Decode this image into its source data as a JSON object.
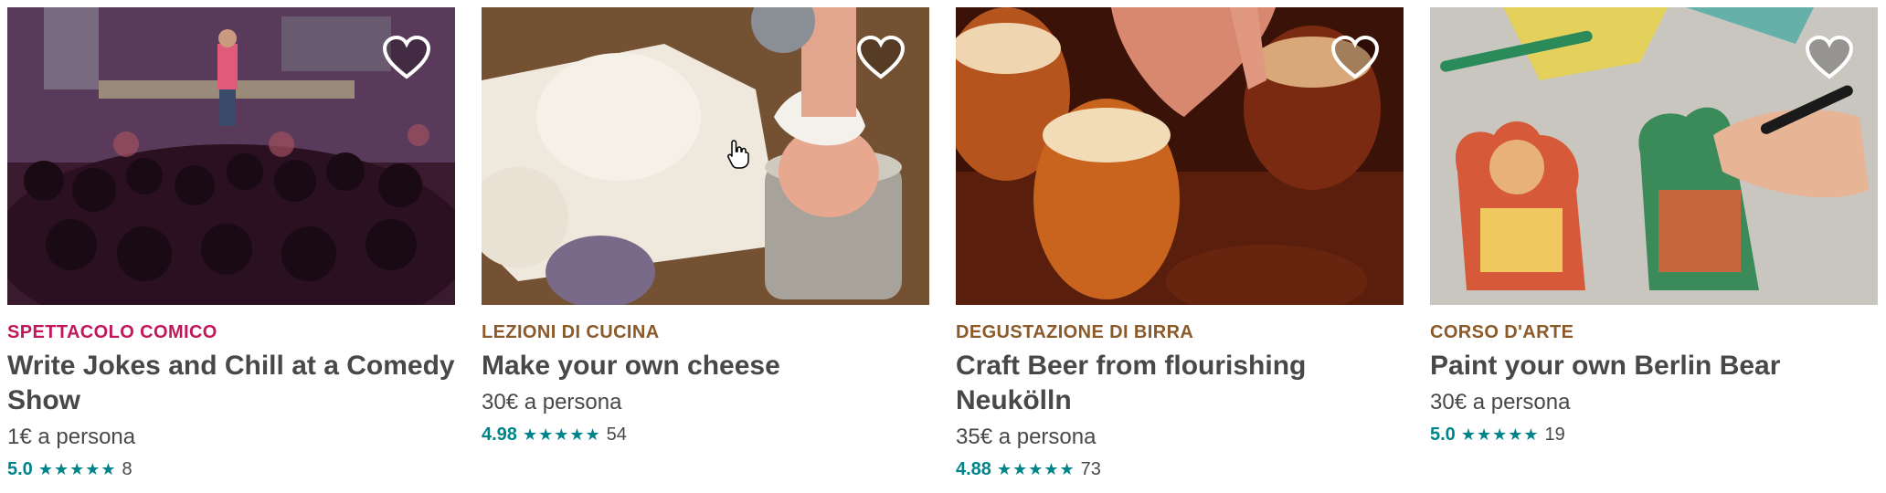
{
  "colors": {
    "comedy": "#c2185b",
    "food": "#8b5a2b",
    "rating": "#008489",
    "text": "#484848"
  },
  "cards": [
    {
      "category": "SPETTACOLO COMICO",
      "category_color": "#c2185b",
      "title": "Write Jokes and Chill at a Comedy Show",
      "price": "1€ a persona",
      "rating": "5.0",
      "stars": "★★★★★",
      "reviews": "8",
      "favorite_icon": "heart-outline-icon"
    },
    {
      "category": "LEZIONI DI CUCINA",
      "category_color": "#8b5a2b",
      "title": "Make your own cheese",
      "price": "30€ a persona",
      "rating": "4.98",
      "stars": "★★★★★",
      "reviews": "54",
      "favorite_icon": "heart-outline-icon"
    },
    {
      "category": "DEGUSTAZIONE DI BIRRA",
      "category_color": "#8b5a2b",
      "title": "Craft Beer from flourishing Neukölln",
      "price": "35€ a persona",
      "rating": "4.88",
      "stars": "★★★★★",
      "reviews": "73",
      "favorite_icon": "heart-outline-icon"
    },
    {
      "category": "CORSO D'ARTE",
      "category_color": "#8b5a2b",
      "title": "Paint your own Berlin Bear",
      "price": "30€ a persona",
      "rating": "5.0",
      "stars": "★★★★★",
      "reviews": "19",
      "favorite_icon": "heart-outline-icon"
    }
  ]
}
